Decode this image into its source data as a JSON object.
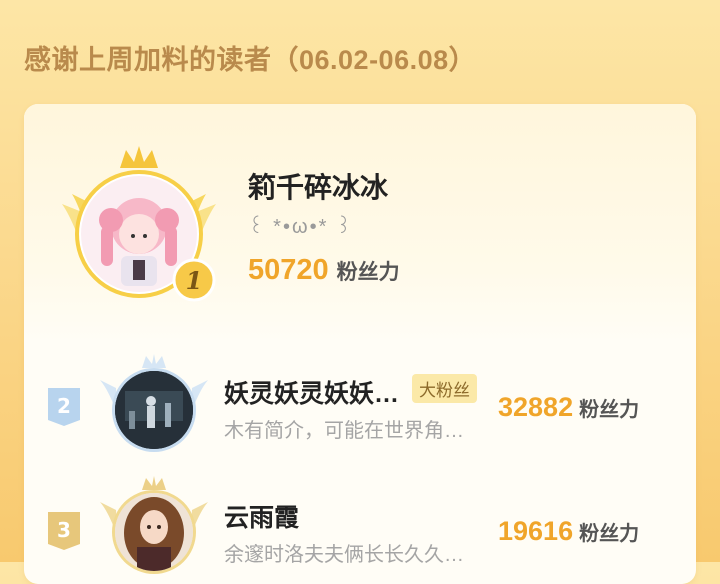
{
  "header": {
    "title": "感谢上周加料的读者（06.02-06.08）"
  },
  "colors": {
    "accent": "#f0a52a",
    "gold": "#f7c948",
    "silver": "#b8d4ee",
    "bronze": "#e7c77b"
  },
  "ranking": [
    {
      "rank": "1",
      "name": "筣千碎冰冰",
      "signature": "꒰ *•ω•* ꒱",
      "fans_count": "50720",
      "fans_label": "粉丝力",
      "badge": "crown-gold-icon"
    },
    {
      "rank": "2",
      "name": "妖灵妖灵妖妖…",
      "tag": "大粉丝",
      "signature": "木有简介，可能在世界角…",
      "fans_count": "32882",
      "fans_label": "粉丝力",
      "badge": "crown-silver-icon"
    },
    {
      "rank": "3",
      "name": "云雨霞",
      "signature": "余邃时洛夫夫俩长长久久…",
      "fans_count": "19616",
      "fans_label": "粉丝力",
      "badge": "crown-bronze-icon"
    }
  ]
}
